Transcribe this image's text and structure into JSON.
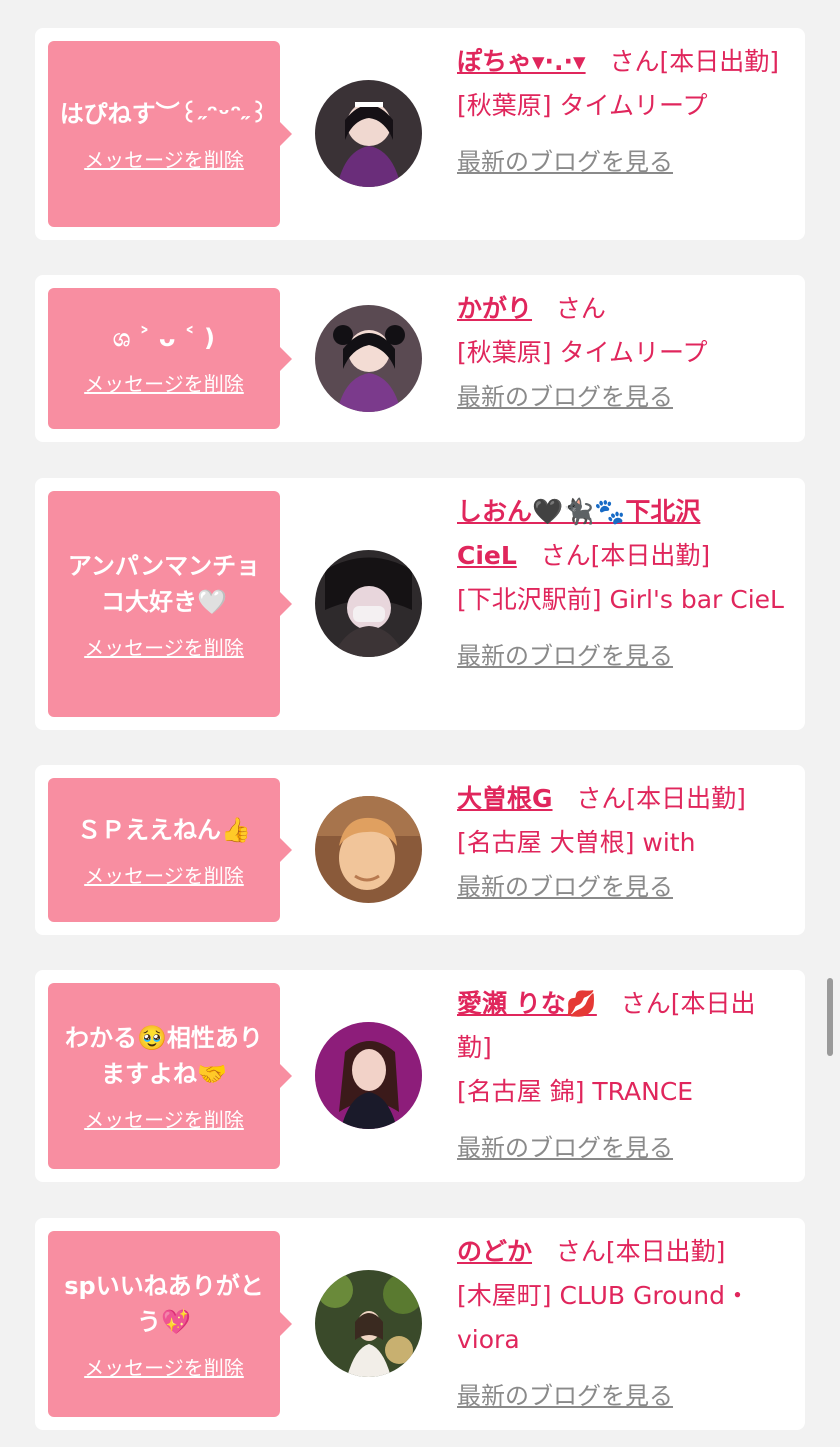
{
  "cards": [
    {
      "message": "はぴねす︶꒰˶ᵔᵕᵔ˶꒱",
      "delete_label": "メッセージを削除",
      "name": "ぽちゃ▾·.·▾",
      "san": "さん",
      "status": "[本日出勤]",
      "shop": "[秋葉原] タイムリープ",
      "blog_label": "最新のブログを見る"
    },
    {
      "message": "ශ ˃ ᴗ ˂ )",
      "delete_label": "メッセージを削除",
      "name": "かがり",
      "san": "さん",
      "status": "",
      "shop": "[秋葉原] タイムリープ",
      "blog_label": "最新のブログを見る"
    },
    {
      "message": "アンパンマンチョコ大好き🤍",
      "delete_label": "メッセージを削除",
      "name": "しおん🖤🐈‍⬛🐾下北沢CieL",
      "san": "さん",
      "status": "[本日出勤]",
      "shop": "[下北沢駅前] Girl's bar CieL",
      "blog_label": "最新のブログを見る"
    },
    {
      "message": "ＳＰええねん👍",
      "delete_label": "メッセージを削除",
      "name": "大曽根G",
      "san": "さん",
      "status": "[本日出勤]",
      "shop": "[名古屋 大曽根] with",
      "blog_label": "最新のブログを見る"
    },
    {
      "message": "わかる🥹相性ありますよね🤝",
      "delete_label": "メッセージを削除",
      "name": "愛瀬 りな💋",
      "san": "さん",
      "status": "[本日出勤]",
      "shop": "[名古屋 錦] TRANCE",
      "blog_label": "最新のブログを見る"
    },
    {
      "message": "spいいねありがとう💖",
      "delete_label": "メッセージを削除",
      "name": "のどか",
      "san": "さん",
      "status": "[本日出勤]",
      "shop": "[木屋町] CLUB Ground・viora",
      "blog_label": "最新のブログを見る"
    }
  ],
  "colors": {
    "background": "#f2f2f2",
    "bubble": "#f88ea1",
    "accent": "#e0265c",
    "link_gray": "#8a8a8a"
  }
}
